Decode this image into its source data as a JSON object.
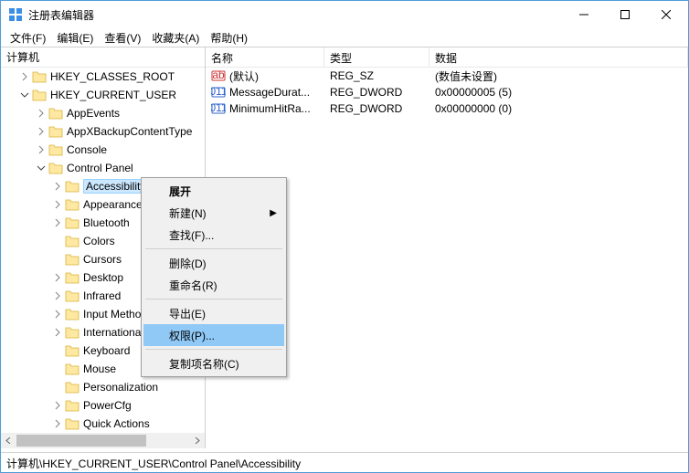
{
  "window": {
    "title": "注册表编辑器"
  },
  "menubar": [
    "文件(F)",
    "编辑(E)",
    "查看(V)",
    "收藏夹(A)",
    "帮助(H)"
  ],
  "tree": {
    "root": "计算机",
    "nodes": [
      {
        "label": "HKEY_CLASSES_ROOT",
        "depth": 1,
        "twisty": "closed"
      },
      {
        "label": "HKEY_CURRENT_USER",
        "depth": 1,
        "twisty": "open"
      },
      {
        "label": "AppEvents",
        "depth": 2,
        "twisty": "closed"
      },
      {
        "label": "AppXBackupContentType",
        "depth": 2,
        "twisty": "closed"
      },
      {
        "label": "Console",
        "depth": 2,
        "twisty": "closed"
      },
      {
        "label": "Control Panel",
        "depth": 2,
        "twisty": "open"
      },
      {
        "label": "Accessibility",
        "depth": 3,
        "twisty": "closed",
        "selected": true
      },
      {
        "label": "Appearance",
        "depth": 3,
        "twisty": "closed"
      },
      {
        "label": "Bluetooth",
        "depth": 3,
        "twisty": "closed"
      },
      {
        "label": "Colors",
        "depth": 3,
        "twisty": "none"
      },
      {
        "label": "Cursors",
        "depth": 3,
        "twisty": "none"
      },
      {
        "label": "Desktop",
        "depth": 3,
        "twisty": "closed"
      },
      {
        "label": "Infrared",
        "depth": 3,
        "twisty": "closed"
      },
      {
        "label": "Input Method",
        "depth": 3,
        "twisty": "closed"
      },
      {
        "label": "International",
        "depth": 3,
        "twisty": "closed"
      },
      {
        "label": "Keyboard",
        "depth": 3,
        "twisty": "none"
      },
      {
        "label": "Mouse",
        "depth": 3,
        "twisty": "none"
      },
      {
        "label": "Personalization",
        "depth": 3,
        "twisty": "none"
      },
      {
        "label": "PowerCfg",
        "depth": 3,
        "twisty": "closed"
      },
      {
        "label": "Quick Actions",
        "depth": 3,
        "twisty": "closed"
      }
    ]
  },
  "list": {
    "cols": {
      "name": "名称",
      "type": "类型",
      "data": "数据"
    },
    "rows": [
      {
        "icon": "str",
        "name": "(默认)",
        "type": "REG_SZ",
        "data": "(数值未设置)"
      },
      {
        "icon": "bin",
        "name": "MessageDurat...",
        "type": "REG_DWORD",
        "data": "0x00000005 (5)"
      },
      {
        "icon": "bin",
        "name": "MinimumHitRa...",
        "type": "REG_DWORD",
        "data": "0x00000000 (0)"
      }
    ]
  },
  "context_menu": {
    "expand": "展开",
    "new": "新建(N)",
    "find": "查找(F)...",
    "delete": "删除(D)",
    "rename": "重命名(R)",
    "export": "导出(E)",
    "permissions": "权限(P)...",
    "copy_key_name": "复制项名称(C)"
  },
  "statusbar": "计算机\\HKEY_CURRENT_USER\\Control Panel\\Accessibility"
}
